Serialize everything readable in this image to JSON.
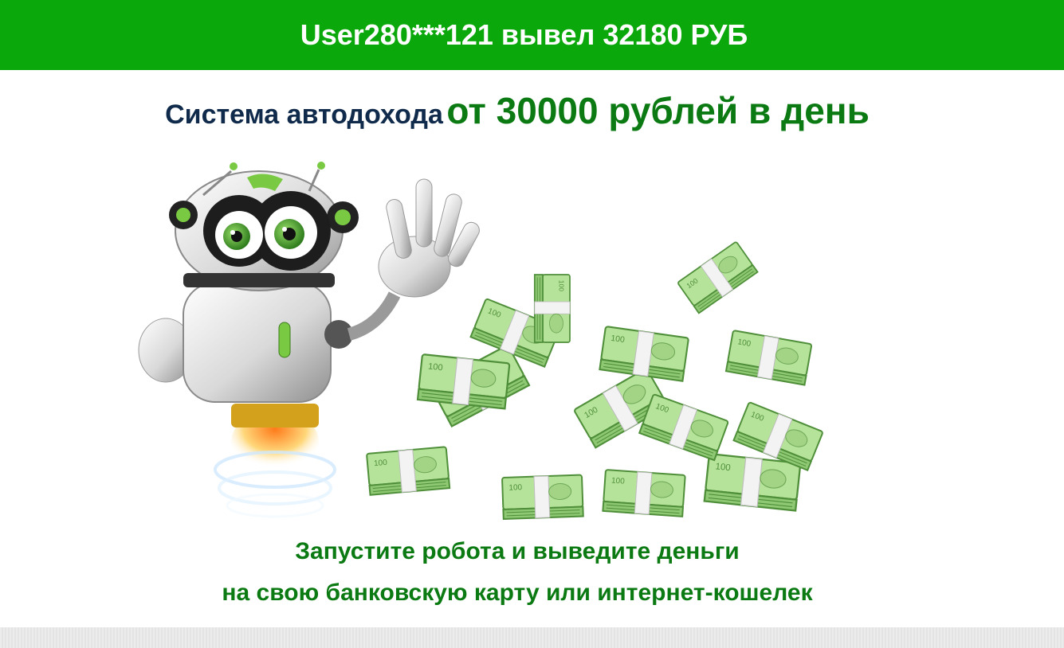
{
  "banner": {
    "text": "User280***121 вывел 32180 РУБ",
    "background": "#0aa80a"
  },
  "headline": {
    "part1": "Система автодохода",
    "part2": "от 30000 рублей в день"
  },
  "illustration": {
    "robot": "robot-waving-icon",
    "money": "money-pile-icon",
    "banknote_label": "100"
  },
  "cta": {
    "line1": "Запустите робота и выведите деньги",
    "line2": "на свою банковскую карту или интернет-кошелек"
  },
  "colors": {
    "accent_green": "#0b7a12",
    "headline_dark": "#0f2a4a"
  }
}
